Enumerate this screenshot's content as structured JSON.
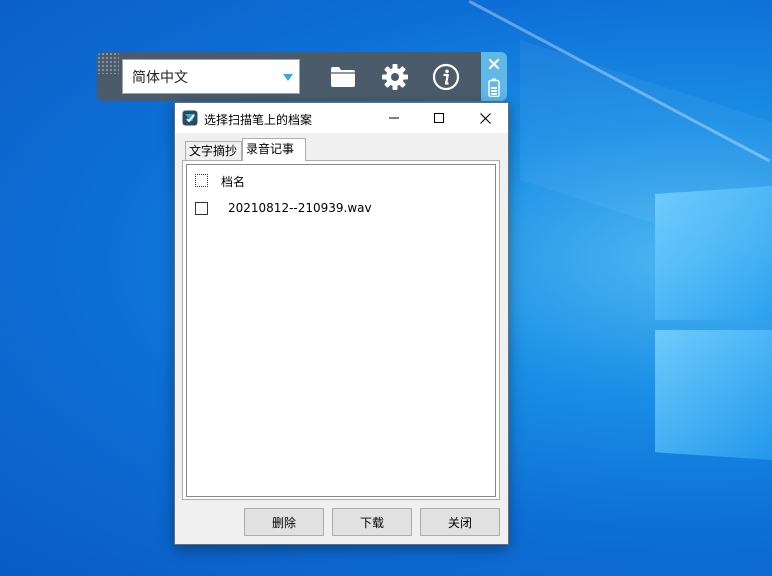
{
  "toolbar": {
    "language_selected": "简体中文",
    "icons": [
      "grip-icon",
      "dropdown-arrow-icon",
      "folder-icon",
      "gear-icon",
      "info-icon",
      "close-icon",
      "battery-icon"
    ]
  },
  "dialog": {
    "title": "选择扫描笔上的档案",
    "window_controls": [
      "minimize-icon",
      "maximize-icon",
      "close-icon"
    ],
    "tabs": [
      {
        "label": "文字摘抄",
        "active": false
      },
      {
        "label": "录音记事",
        "active": true
      }
    ],
    "list": {
      "header": "档名",
      "rows": [
        {
          "filename": "20210812--210939.wav",
          "checked": false
        }
      ]
    },
    "buttons": {
      "delete": "删除",
      "download": "下载",
      "close": "关闭"
    }
  },
  "colors": {
    "desktop": "#0d6fd6",
    "toolbar": "#4c5b6a",
    "toolbar_accent": "#5fb8e6",
    "dropdown_arrow": "#3aa8d8"
  }
}
